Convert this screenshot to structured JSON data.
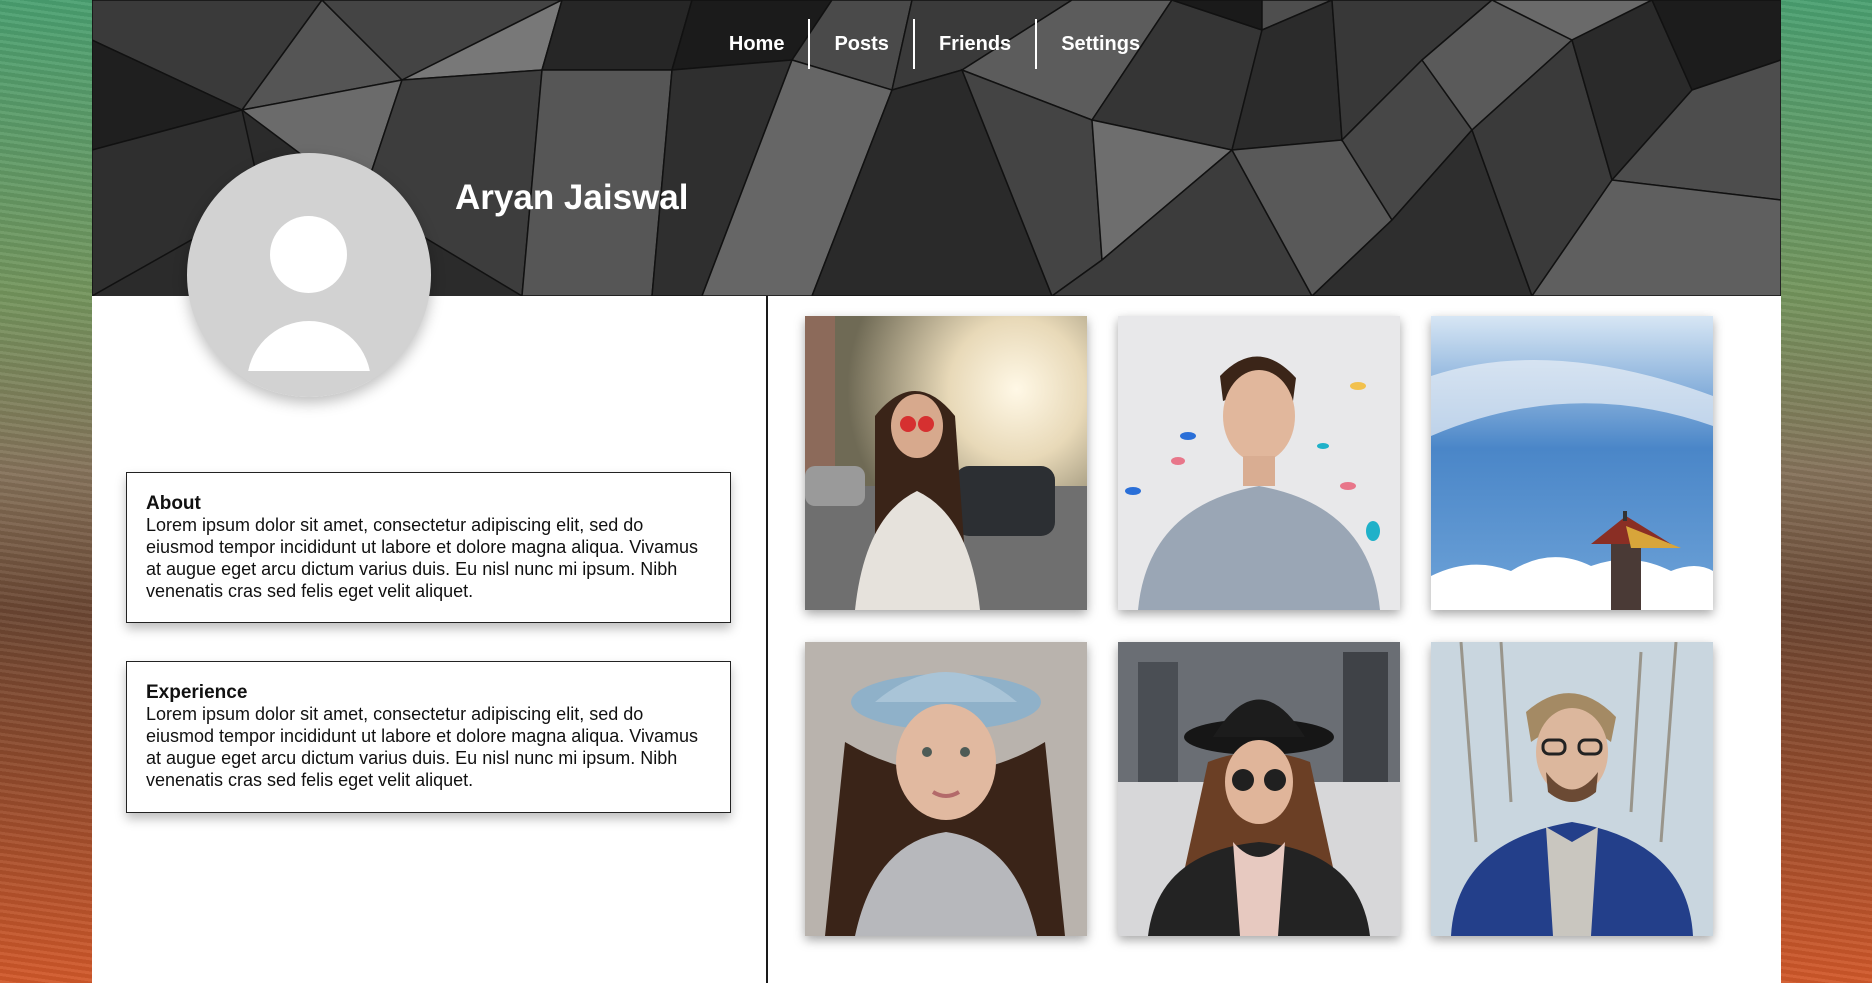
{
  "nav": {
    "items": [
      {
        "label": "Home"
      },
      {
        "label": "Posts"
      },
      {
        "label": "Friends"
      },
      {
        "label": "Settings"
      }
    ]
  },
  "profile": {
    "name": "Aryan Jaiswal"
  },
  "about": {
    "title": "About",
    "text": "Lorem ipsum dolor sit amet, consectetur adipiscing elit, sed do eiusmod tempor incididunt ut labore et dolore magna aliqua. Vivamus at augue eget arcu dictum varius duis. Eu nisl nunc mi ipsum. Nibh venenatis cras sed felis eget velit aliquet."
  },
  "experience": {
    "title": "Experience",
    "text": "Lorem ipsum dolor sit amet, consectetur adipiscing elit, sed do eiusmod tempor incididunt ut labore et dolore magna aliqua. Vivamus at augue eget arcu dictum varius duis. Eu nisl nunc mi ipsum. Nibh venenatis cras sed felis eget velit aliquet."
  },
  "gallery": {
    "photos": [
      {
        "subject": "woman-heart-sunglasses-street"
      },
      {
        "subject": "young-man-confetti"
      },
      {
        "subject": "sky-clouds-tower"
      },
      {
        "subject": "woman-denim-hat"
      },
      {
        "subject": "woman-black-hat-round-sunglasses"
      },
      {
        "subject": "man-glasses-blue-jacket"
      }
    ]
  }
}
